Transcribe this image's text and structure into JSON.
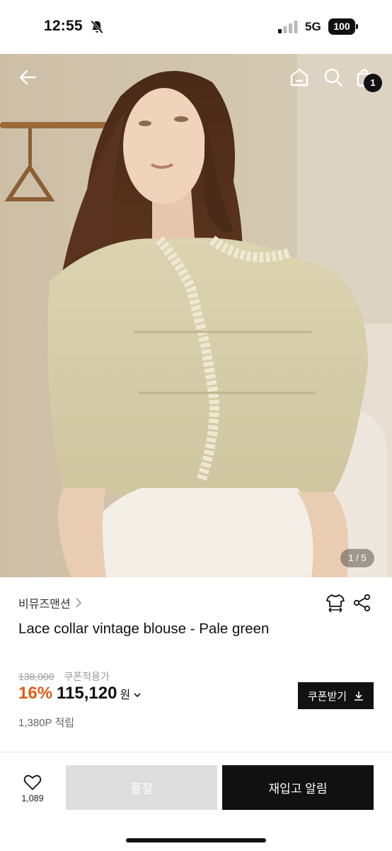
{
  "status_bar": {
    "time": "12:55",
    "network": "5G",
    "battery": "100",
    "icons": [
      "bell-slash-icon",
      "signal-icon"
    ]
  },
  "top_nav": {
    "icons": [
      "back-arrow-icon",
      "home-icon",
      "search-icon",
      "shopping-bag-icon"
    ],
    "cart_count": "1"
  },
  "gallery": {
    "indicator": "1 / 5"
  },
  "product": {
    "brand": "비뮤즈맨션",
    "title": "Lace collar vintage blouse - Pale green",
    "original_price": "138,000",
    "coupon_note": "쿠폰적용가",
    "discount": "16%",
    "price": "115,120",
    "currency": "원",
    "points": "1,380P 적립",
    "coupon_button": "쿠폰받기"
  },
  "bottom_bar": {
    "like_count": "1,089",
    "soldout_label": "품절",
    "restock_label": "재입고 알림"
  },
  "colors": {
    "discount": "#e65b17",
    "primary": "#111111",
    "disabled": "#dedede"
  }
}
